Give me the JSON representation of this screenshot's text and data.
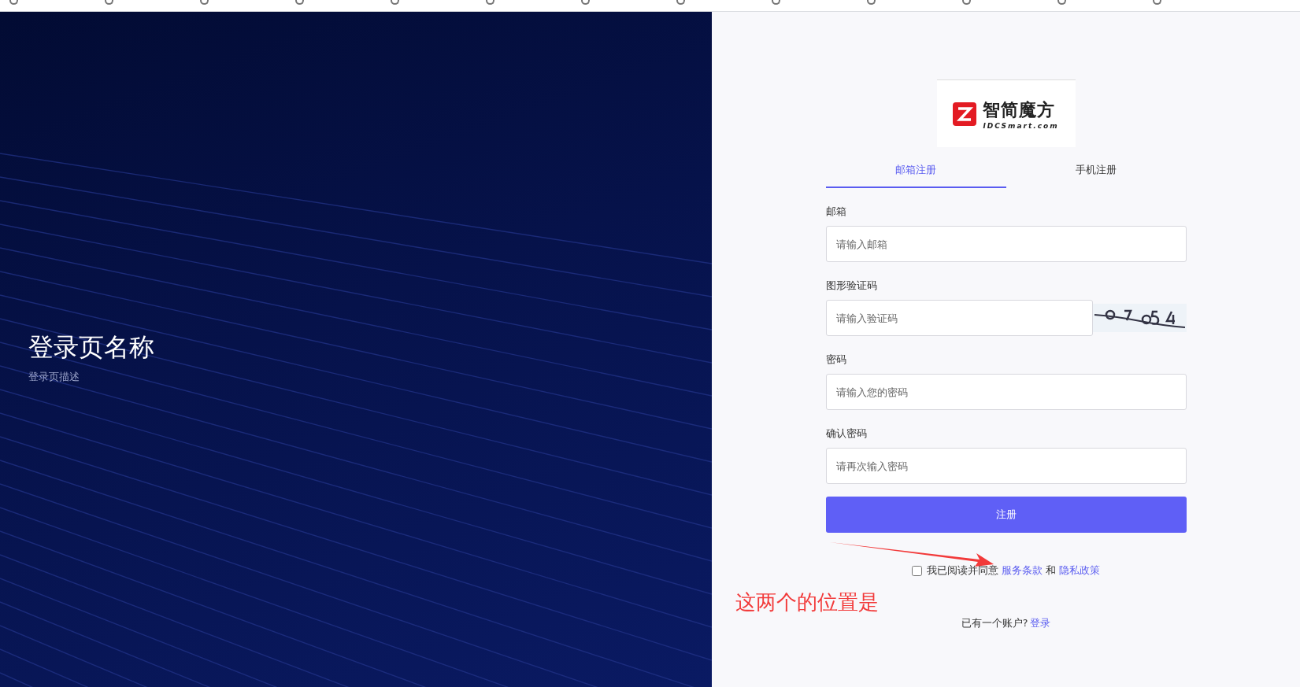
{
  "hero": {
    "title": "登录页名称",
    "description": "登录页描述"
  },
  "logo": {
    "name": "智简魔方",
    "domain": "IDCSmart.com"
  },
  "tabs": [
    {
      "label": "邮箱注册",
      "selected": true
    },
    {
      "label": "手机注册",
      "selected": false
    }
  ],
  "fields": [
    {
      "label": "邮箱",
      "placeholder": "请输入邮箱",
      "kind": "text"
    },
    {
      "label": "图形验证码",
      "placeholder": "请输入验证码",
      "kind": "captcha"
    },
    {
      "label": "密码",
      "placeholder": "请输入您的密码",
      "kind": "password"
    },
    {
      "label": "确认密码",
      "placeholder": "请再次输入密码",
      "kind": "password"
    }
  ],
  "submit": "注册",
  "agreement": {
    "checked": false,
    "text": "我已阅读并同意",
    "terms": "服务条款",
    "and": "和",
    "privacy": "隐私政策"
  },
  "login_prompt": {
    "text": "已有一个账户?",
    "link": "登录"
  },
  "annotation": {
    "text": "这两个的位置是"
  }
}
